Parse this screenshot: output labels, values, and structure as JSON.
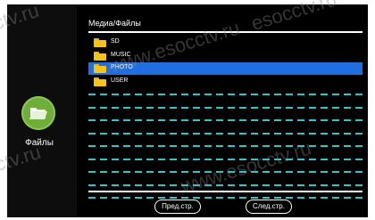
{
  "sidebar": {
    "app_icon": "folder-icon",
    "app_label": "Файлы"
  },
  "browser": {
    "path_title": "Медиа/Файлы",
    "items": [
      {
        "label": "SD",
        "icon": "folder-icon",
        "selected": false
      },
      {
        "label": "MUSIC",
        "icon": "folder-icon",
        "selected": false
      },
      {
        "label": "PHOTO",
        "icon": "folder-icon",
        "selected": true
      },
      {
        "label": "USER",
        "icon": "folder-icon",
        "selected": false
      }
    ],
    "empty_rows": 9
  },
  "pager": {
    "prev_label": "Пред.стр.",
    "next_label": "След.стр."
  },
  "watermark": {
    "text_1": "www.esocctv.ru",
    "text_2": "esocctv.ru",
    "text_3": "ctv.ru",
    "text_4": "ctv.ru",
    "text_5": "www.esocctv.ru"
  },
  "colors": {
    "selection": "#1f6fe0",
    "dash": "#2ec6c6",
    "folder": "#f5c418",
    "app_icon": "#6fae3a"
  }
}
